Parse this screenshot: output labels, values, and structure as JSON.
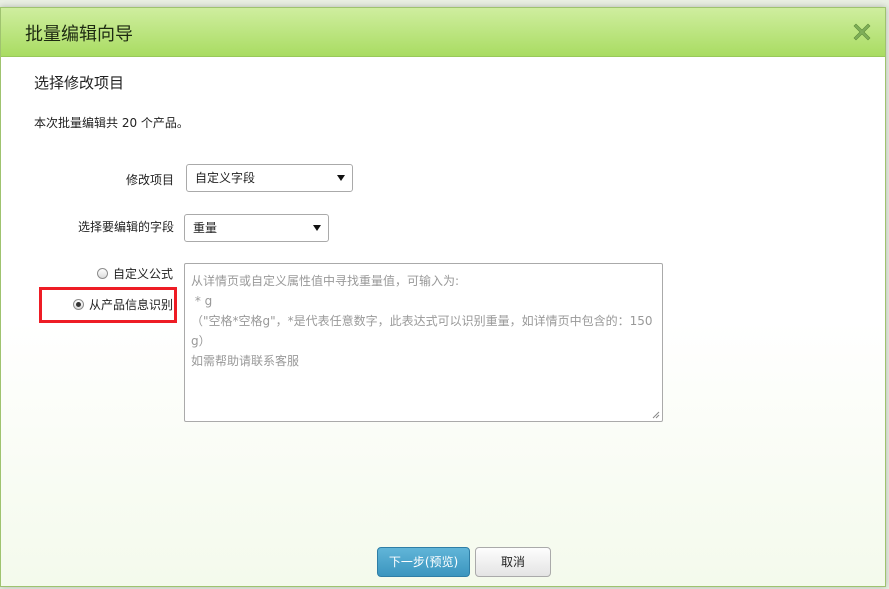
{
  "dialog": {
    "title": "批量编辑向导",
    "close_icon": "close-icon",
    "close_color": "#7fae5a"
  },
  "content": {
    "section_title": "选择修改项目",
    "note": "本次批量编辑共 20 个产品。",
    "modify_item": {
      "label": "修改项目",
      "selected": "自定义字段"
    },
    "field": {
      "label": "选择要编辑的字段",
      "selected": "重量"
    },
    "options": [
      {
        "label": "自定义公式",
        "checked": false
      },
      {
        "label": "从产品信息识别",
        "checked": true
      }
    ],
    "hint_lines": [
      "从详情页或自定义属性值中寻找重量值，可输入为:",
      " * g",
      "",
      "（\"空格*空格g\"，*是代表任意数字，此表达式可以识别重量，如详情页中包含的：150",
      "g）",
      "如需帮助请联系客服"
    ]
  },
  "buttons": {
    "next": "下一步(预览)",
    "cancel": "取消"
  },
  "colors": {
    "titlebar": "#b5e274",
    "primary": "#4aa3cb",
    "highlight": "#ee1c25"
  }
}
